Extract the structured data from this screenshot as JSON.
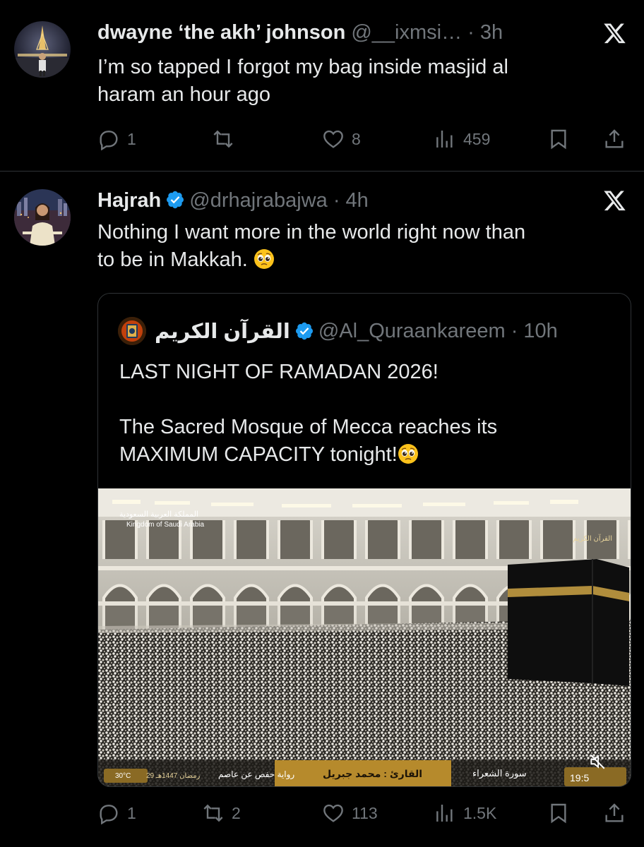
{
  "tweets": [
    {
      "name": "dwayne ‘the akh’ johnson",
      "handle": "@__ixmsi…",
      "time": "· 3h",
      "text": "I’m so tapped I forgot my bag inside masjid al\nharam an hour ago",
      "actions": {
        "replies": "1",
        "reposts": "",
        "likes": "8",
        "views": "459"
      }
    },
    {
      "name": "Hajrah",
      "handle": "@drhajrabajwa",
      "time": "· 4h",
      "text": "Nothing I want more in the world right now than\nto be in Makkah.",
      "actions": {
        "replies": "1",
        "reposts": "2",
        "likes": "113",
        "views": "1.5K"
      },
      "quote": {
        "name": "القرآن الكريم",
        "handle": "@Al_Quraankareem",
        "time": "· 10h",
        "text": "LAST NIGHT OF RAMADAN 2026!\n\nThe Sacred Mosque of Mecca reaches its\nMAXIMUM CAPACITY tonight!",
        "video": {
          "logo_ar": "المملكة العربية السعودية",
          "logo_en": "Kingdom of Saudi Arabia",
          "channel": "القرآن الكريم",
          "temperature": "30°C",
          "hijri_date": "29 رمضان 1447هـ",
          "narration": "رواية حفص عن عاصم",
          "reciter": "القارئ : محمد جبريل",
          "surah": "سورة الشعراء",
          "clock": "19:5"
        }
      }
    }
  ],
  "icons": {
    "reply": "reply-icon",
    "repost": "repost-icon",
    "like": "heart-icon",
    "views": "views-icon",
    "bookmark": "bookmark-icon",
    "share": "share-icon",
    "platform": "x-logo-icon",
    "verified": "verified-badge-icon",
    "mute": "mute-icon"
  },
  "colors": {
    "background": "#000000",
    "text": "#e7e9ea",
    "secondary": "#71767b",
    "verified": "#1d9bf0",
    "divider": "#2f3336"
  }
}
